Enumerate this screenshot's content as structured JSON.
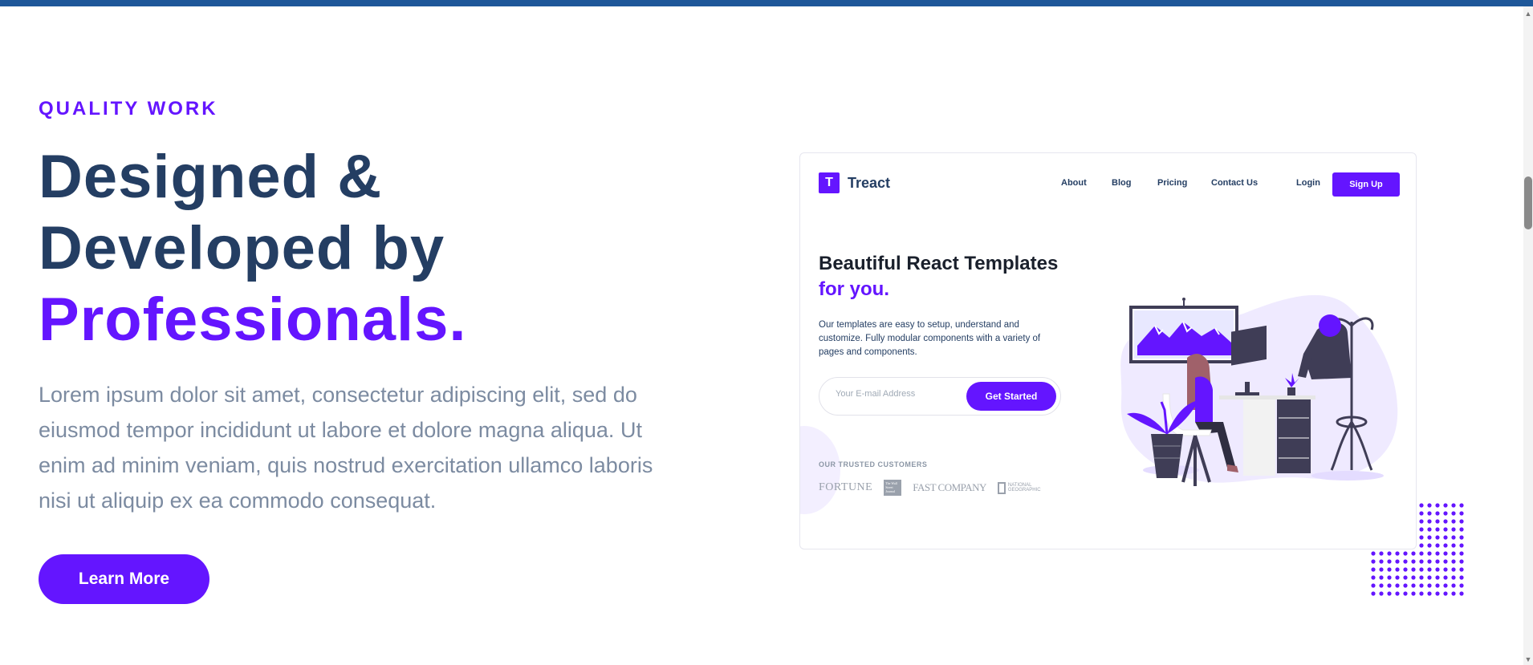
{
  "hero": {
    "eyebrow": "QUALITY WORK",
    "headline_line1": "Designed &",
    "headline_line2": "Developed by",
    "headline_accent": "Professionals",
    "headline_period": ".",
    "description": "Lorem ipsum dolor sit amet, consectetur adipiscing elit, sed do eiusmod tempor incididunt ut labore et dolore magna aliqua. Ut enim ad minim veniam, quis nostrud exercitation ullamco laboris nisi ut aliquip ex ea commodo consequat.",
    "cta_label": "Learn More"
  },
  "preview": {
    "logo_letter": "T",
    "logo_text": "Treact",
    "nav": [
      "About",
      "Blog",
      "Pricing",
      "Contact Us"
    ],
    "login_label": "Login",
    "signup_label": "Sign Up",
    "title_main": "Beautiful React Templates",
    "title_accent": "for you.",
    "description": "Our templates are easy to setup, understand and customize. Fully modular components with a variety of pages and components.",
    "email_placeholder": "Your E-mail Address",
    "get_started_label": "Get Started",
    "trusted_label": "OUR TRUSTED CUSTOMERS",
    "customers": [
      "FORTUNE",
      "The Wall Street Journal",
      "FAST COMPANY",
      "NATIONAL GEOGRAPHIC"
    ]
  },
  "colors": {
    "accent": "#6415ff",
    "heading": "#243e63",
    "body_text": "#7c8ba1",
    "top_bar": "#1e5799"
  }
}
